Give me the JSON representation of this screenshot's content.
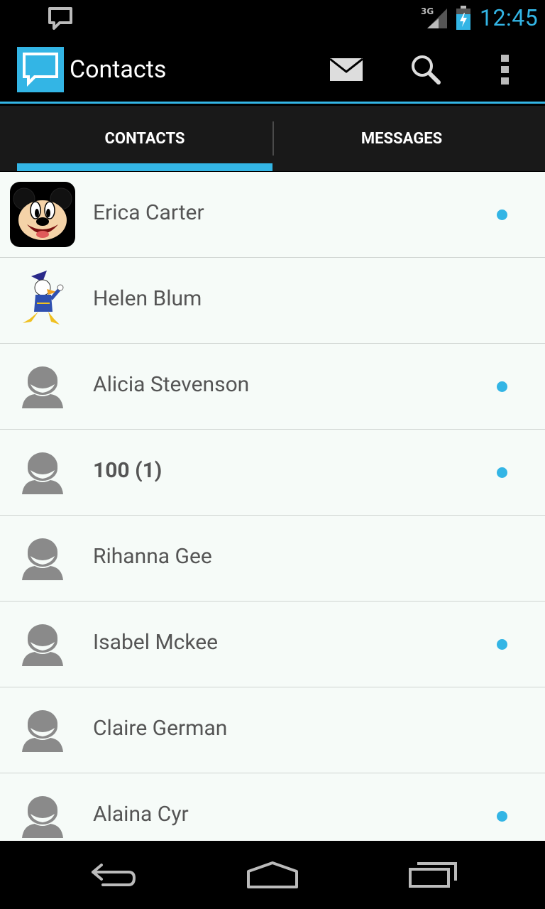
{
  "status_bar": {
    "network": "3G",
    "time": "12:45"
  },
  "action_bar": {
    "title": "Contacts",
    "actions": [
      "mail-icon",
      "search-icon",
      "overflow-menu-icon"
    ]
  },
  "tabs": [
    {
      "label": "CONTACTS",
      "selected": true
    },
    {
      "label": "MESSAGES",
      "selected": false
    }
  ],
  "contacts": [
    {
      "name": "Erica Carter",
      "avatar": "mickey-avatar",
      "unread": true,
      "bold": false
    },
    {
      "name": "Helen Blum",
      "avatar": "donald-avatar",
      "unread": false,
      "bold": false
    },
    {
      "name": "Alicia Stevenson",
      "avatar": "default-avatar",
      "unread": true,
      "bold": false
    },
    {
      "name": "100 (1)",
      "avatar": "default-avatar",
      "unread": true,
      "bold": true
    },
    {
      "name": "Rihanna Gee",
      "avatar": "default-avatar",
      "unread": false,
      "bold": false
    },
    {
      "name": "Isabel Mckee",
      "avatar": "default-avatar",
      "unread": true,
      "bold": false
    },
    {
      "name": "Claire German",
      "avatar": "default-avatar",
      "unread": false,
      "bold": false
    },
    {
      "name": "Alaina Cyr",
      "avatar": "default-avatar",
      "unread": true,
      "bold": false
    }
  ],
  "colors": {
    "accent": "#33b5e5",
    "list_background": "#f6fbf8",
    "text": "#555555"
  }
}
